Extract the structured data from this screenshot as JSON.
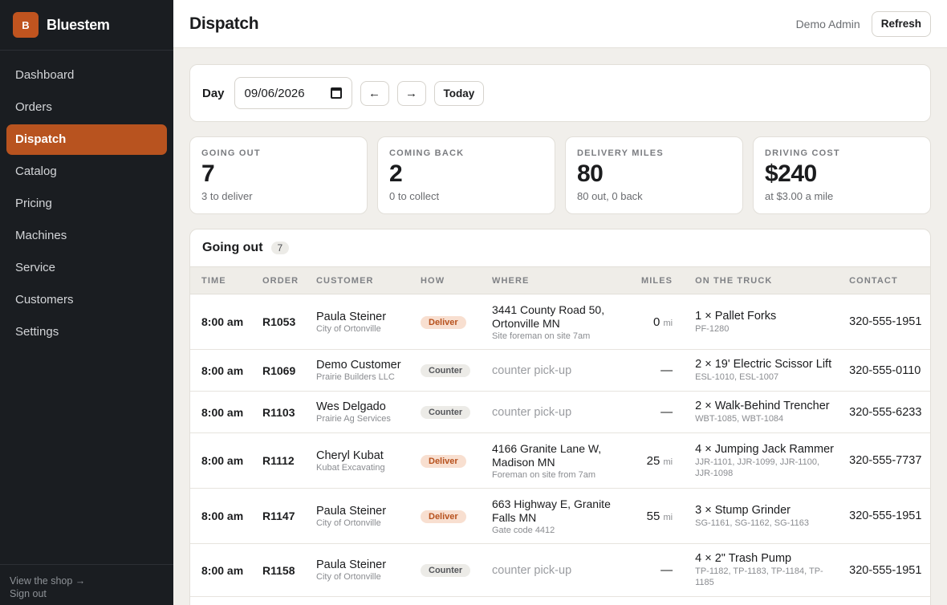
{
  "brand": {
    "logo_letter": "B",
    "name": "Bluestem"
  },
  "nav": [
    {
      "label": "Dashboard",
      "active": false
    },
    {
      "label": "Orders",
      "active": false
    },
    {
      "label": "Dispatch",
      "active": true
    },
    {
      "label": "Catalog",
      "active": false
    },
    {
      "label": "Pricing",
      "active": false
    },
    {
      "label": "Machines",
      "active": false
    },
    {
      "label": "Service",
      "active": false
    },
    {
      "label": "Customers",
      "active": false
    },
    {
      "label": "Settings",
      "active": false
    }
  ],
  "sidebar_footer": {
    "view_shop": "View the shop →",
    "sign_out": "Sign out"
  },
  "header": {
    "title": "Dispatch",
    "user": "Demo Admin",
    "refresh_label": "Refresh"
  },
  "daybar": {
    "label": "Day",
    "date_value": "09/06/2026",
    "prev_label": "←",
    "next_label": "→",
    "today_label": "Today"
  },
  "stats": [
    {
      "label": "GOING OUT",
      "value": "7",
      "sub": "3 to deliver"
    },
    {
      "label": "COMING BACK",
      "value": "2",
      "sub": "0 to collect"
    },
    {
      "label": "DELIVERY MILES",
      "value": "80",
      "sub": "80 out, 0 back"
    },
    {
      "label": "DRIVING COST",
      "value": "$240",
      "sub": "at $3.00 a mile"
    }
  ],
  "going_out": {
    "title": "Going out",
    "count": "7",
    "columns": [
      "TIME",
      "ORDER",
      "CUSTOMER",
      "HOW",
      "WHERE",
      "MILES",
      "ON THE TRUCK",
      "CONTACT"
    ],
    "rows": [
      {
        "time": "8:00 am",
        "order": "R1053",
        "customer": "Paula Steiner",
        "org": "City of Ortonville",
        "how": "Deliver",
        "where": "3441 County Road 50, Ortonville MN",
        "note": "Site foreman on site 7am",
        "miles": "0",
        "mi": "mi",
        "item": "1 × Pallet Forks",
        "units": "PF-1280",
        "contact": "320-555-1951"
      },
      {
        "time": "8:00 am",
        "order": "R1069",
        "customer": "Demo Customer",
        "org": "Prairie Builders LLC",
        "how": "Counter",
        "where": "counter pick-up",
        "note": "",
        "miles": "—",
        "mi": "",
        "item": "2 × 19' Electric Scissor Lift",
        "units": "ESL-1010, ESL-1007",
        "contact": "320-555-0110"
      },
      {
        "time": "8:00 am",
        "order": "R1103",
        "customer": "Wes Delgado",
        "org": "Prairie Ag Services",
        "how": "Counter",
        "where": "counter pick-up",
        "note": "",
        "miles": "—",
        "mi": "",
        "item": "2 × Walk-Behind Trencher",
        "units": "WBT-1085, WBT-1084",
        "contact": "320-555-6233"
      },
      {
        "time": "8:00 am",
        "order": "R1112",
        "customer": "Cheryl Kubat",
        "org": "Kubat Excavating",
        "how": "Deliver",
        "where": "4166 Granite Lane W, Madison MN",
        "note": "Foreman on site from 7am",
        "miles": "25",
        "mi": "mi",
        "item": "4 × Jumping Jack Rammer",
        "units": "JJR-1101, JJR-1099, JJR-1100, JJR-1098",
        "contact": "320-555-7737"
      },
      {
        "time": "8:00 am",
        "order": "R1147",
        "customer": "Paula Steiner",
        "org": "City of Ortonville",
        "how": "Deliver",
        "where": "663 Highway E, Granite Falls MN",
        "note": "Gate code 4412",
        "miles": "55",
        "mi": "mi",
        "item": "3 × Stump Grinder",
        "units": "SG-1161, SG-1162, SG-1163",
        "contact": "320-555-1951"
      },
      {
        "time": "8:00 am",
        "order": "R1158",
        "customer": "Paula Steiner",
        "org": "City of Ortonville",
        "how": "Counter",
        "where": "counter pick-up",
        "note": "",
        "miles": "—",
        "mi": "",
        "item": "4 × 2\" Trash Pump",
        "units": "TP-1182, TP-1183, TP-1184, TP-1185",
        "contact": "320-555-1951"
      }
    ]
  },
  "colors": {
    "accent": "#b8531f",
    "sidebar_bg": "#1a1d21",
    "page_bg": "#f1efeb"
  }
}
